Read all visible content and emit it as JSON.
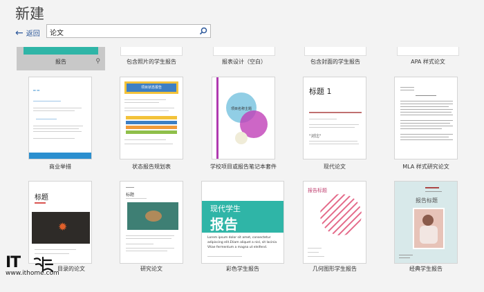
{
  "header": {
    "title": "新建",
    "back_label": "返回"
  },
  "search": {
    "value": "论文"
  },
  "row1": [
    {
      "label": "报告",
      "selected": true
    },
    {
      "label": "包含照片的学生报告"
    },
    {
      "label": "报表设计（空白）"
    },
    {
      "label": "包含封面的学生报告"
    },
    {
      "label": "APA 样式论文"
    }
  ],
  "row2": [
    {
      "label": "商业举措"
    },
    {
      "label": "状态报告规划表"
    },
    {
      "label": "学校项目或报告笔记本套件"
    },
    {
      "label": "现代论文"
    },
    {
      "label": "MLA 样式研究论文"
    }
  ],
  "row3": [
    {
      "label": "目录的论文"
    },
    {
      "label": "研究论文"
    },
    {
      "label": "彩色学生报告"
    },
    {
      "label": "几何图形学生报告"
    },
    {
      "label": "经典学生报告"
    }
  ],
  "thumbs": {
    "modern_title": "标题 1",
    "modern_sub": "\"对比\"",
    "color_title": "现代学生",
    "color_big": "报告",
    "color_body": "Lorem ipsum dolor sit amet, consectetur adipiscing elit.Etiam aliquet a nisl, sit lacinia Vitae fermentum a magna ut eleifend.",
    "geo_title": "报告标题",
    "classic_title": "报告标题",
    "toc_title": "标题",
    "research_title": "标题",
    "status_title": "项目状态报告",
    "school_title": "项目名称主题"
  },
  "watermark": {
    "brand": "IT",
    "url": "www.ithome.com"
  },
  "colors": {
    "accent": "#2b579a",
    "teal": "#2fb5a7",
    "purple": "#c040b8"
  }
}
